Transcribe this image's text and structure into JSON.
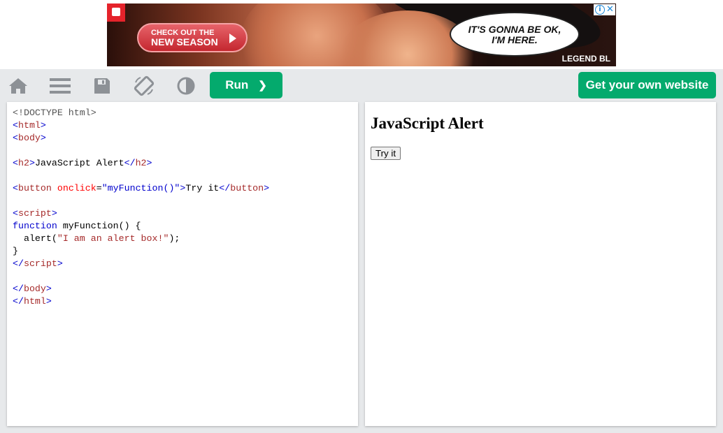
{
  "ad": {
    "cta_line1": "CHECK OUT THE",
    "cta_line2": "NEW SEASON",
    "bubble_line1": "IT'S GONNA BE OK,",
    "bubble_line2": "I'M HERE.",
    "brand": "LEGEND BL",
    "info_icon": "i",
    "close_icon": "✕"
  },
  "toolbar": {
    "icons": [
      "home-icon",
      "menu-icon",
      "save-icon",
      "rotate-icon",
      "contrast-icon"
    ],
    "run_label": "Run",
    "run_chevron": "❯",
    "get_website_label": "Get your own website",
    "icon_color": "#8d9196",
    "button_color": "#04aa6d"
  },
  "editor": {
    "lines": [
      [
        [
          "doc",
          "<!DOCTYPE html>"
        ]
      ],
      [
        [
          "br",
          "<"
        ],
        [
          "tag",
          "html"
        ],
        [
          "br",
          ">"
        ]
      ],
      [
        [
          "br",
          "<"
        ],
        [
          "tag",
          "body"
        ],
        [
          "br",
          ">"
        ]
      ],
      [],
      [
        [
          "br",
          "<"
        ],
        [
          "tag",
          "h2"
        ],
        [
          "br",
          ">"
        ],
        [
          "txt",
          "JavaScript Alert"
        ],
        [
          "br",
          "</"
        ],
        [
          "tag",
          "h2"
        ],
        [
          "br",
          ">"
        ]
      ],
      [],
      [
        [
          "br",
          "<"
        ],
        [
          "tag",
          "button"
        ],
        [
          "txt",
          " "
        ],
        [
          "attr",
          "onclick"
        ],
        [
          "txt",
          "="
        ],
        [
          "val",
          "\"myFunction()\""
        ],
        [
          "br",
          ">"
        ],
        [
          "txt",
          "Try it"
        ],
        [
          "br",
          "</"
        ],
        [
          "tag",
          "button"
        ],
        [
          "br",
          ">"
        ]
      ],
      [],
      [
        [
          "br",
          "<"
        ],
        [
          "tag",
          "script"
        ],
        [
          "br",
          ">"
        ]
      ],
      [
        [
          "kw",
          "function"
        ],
        [
          "txt",
          " myFunction() {"
        ]
      ],
      [
        [
          "txt",
          "  alert("
        ],
        [
          "str",
          "\"I am an alert box!\""
        ],
        [
          "txt",
          ");"
        ]
      ],
      [
        [
          "txt",
          "}"
        ]
      ],
      [
        [
          "br",
          "</"
        ],
        [
          "tag",
          "script"
        ],
        [
          "br",
          ">"
        ]
      ],
      [],
      [
        [
          "br",
          "</"
        ],
        [
          "tag",
          "body"
        ],
        [
          "br",
          ">"
        ]
      ],
      [
        [
          "br",
          "</"
        ],
        [
          "tag",
          "html"
        ],
        [
          "br",
          ">"
        ]
      ]
    ]
  },
  "result": {
    "heading": "JavaScript Alert",
    "button_label": "Try it"
  }
}
